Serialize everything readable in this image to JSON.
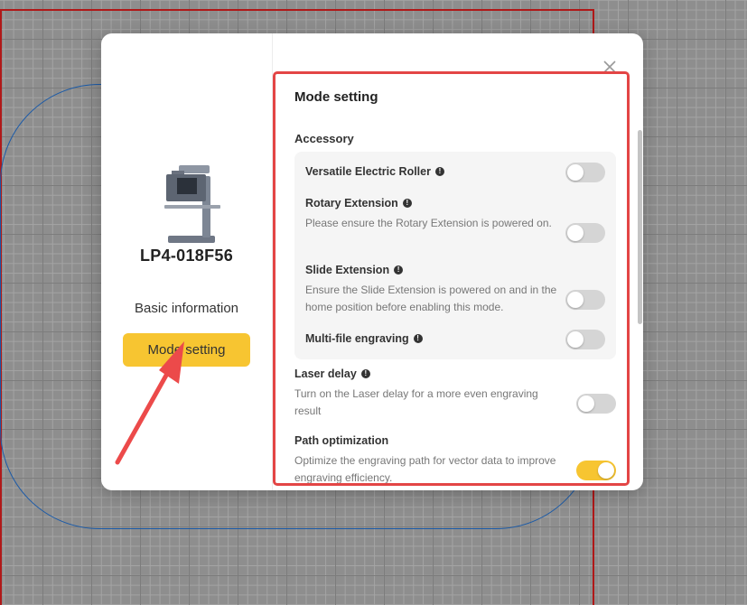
{
  "device": {
    "name": "LP4-018F56"
  },
  "nav": {
    "basic": "Basic information",
    "mode": "Mode setting"
  },
  "panel": {
    "title": "Mode setting",
    "accessory_label": "Accessory",
    "items": [
      {
        "label": "Versatile Electric Roller",
        "desc": "",
        "enabled": false
      },
      {
        "label": "Rotary Extension",
        "desc": "Please ensure the Rotary Extension is powered on.",
        "enabled": false
      },
      {
        "label": "Slide Extension",
        "desc": "Ensure the Slide Extension is powered on and in the home position before enabling this mode.",
        "enabled": false
      },
      {
        "label": "Multi-file engraving",
        "desc": "",
        "enabled": false
      }
    ],
    "laser_delay": {
      "label": "Laser delay",
      "desc": "Turn on the Laser delay for a more even engraving result",
      "enabled": false
    },
    "path_opt": {
      "label": "Path optimization",
      "desc": "Optimize the engraving path for vector data to improve engraving efficiency.",
      "enabled": true
    }
  },
  "colors": {
    "accent": "#f7c531",
    "highlight": "#e34545"
  },
  "icons": {
    "close": "close-icon",
    "info": "info-icon"
  }
}
